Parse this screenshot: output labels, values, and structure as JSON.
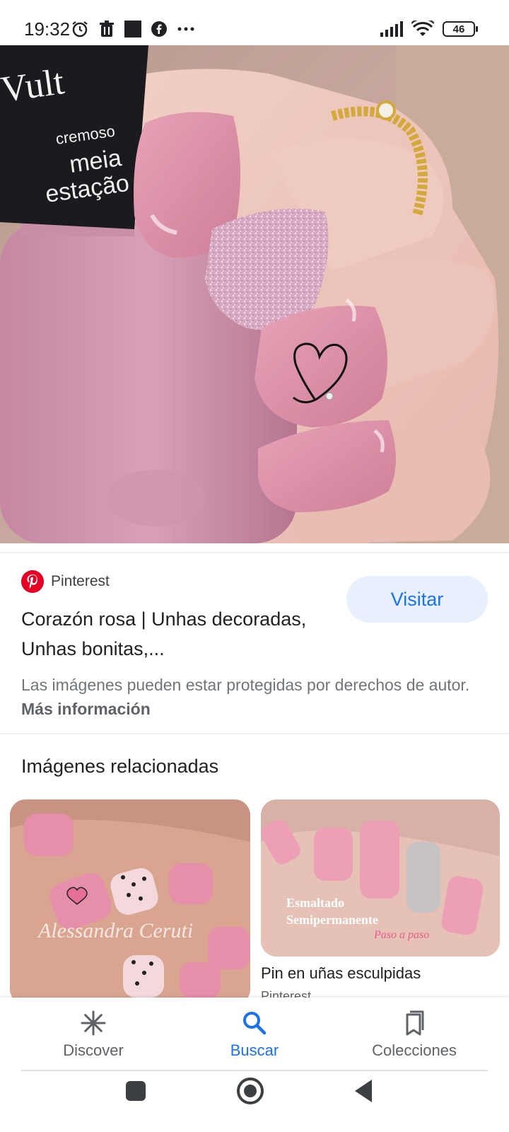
{
  "status_bar": {
    "time": "19:32",
    "battery": "46",
    "icons_left": [
      "alarm-icon",
      "trash-icon",
      "square-icon",
      "facebook-icon",
      "more-icon"
    ],
    "icons_right": [
      "signal-icon",
      "wifi-icon",
      "battery-icon"
    ]
  },
  "hero_image": {
    "bottle_text_brand": "Vult",
    "bottle_text_line1": "cremoso",
    "bottle_text_line2": "meia",
    "bottle_text_line3": "estação"
  },
  "source": {
    "name": "Pinterest",
    "visit_label": "Visitar",
    "title": "Corazón rosa | Unhas decoradas, Unhas bonitas,...",
    "notice_text": "Las imágenes pueden estar protegidas por derechos de autor.",
    "notice_link": "Más información"
  },
  "related": {
    "heading": "Imágenes relacionadas",
    "items": [
      {
        "watermark": "Alessandra Ceruti"
      },
      {
        "overlay_line1": "Esmaltado",
        "overlay_line2": "Semipermanente",
        "overlay_line3": "Paso a paso",
        "caption": "Pin en uñas esculpidas",
        "source": "Pinterest"
      }
    ]
  },
  "bottom_nav": {
    "items": [
      {
        "label": "Discover",
        "icon": "asterisk-icon"
      },
      {
        "label": "Buscar",
        "icon": "search-icon"
      },
      {
        "label": "Colecciones",
        "icon": "collections-icon"
      }
    ],
    "active_color": "#1a73e8"
  },
  "colors": {
    "accent": "#1a73e8",
    "visit_bg": "#e8f0fe",
    "pinterest": "#e60023",
    "nail_pink": "#d98aa3"
  }
}
